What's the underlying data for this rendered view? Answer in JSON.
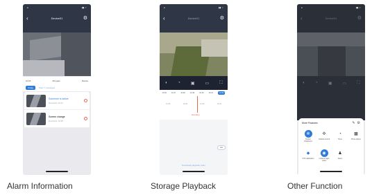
{
  "labels": {
    "alarm": "Alarm Information",
    "playback": "Storage Playback",
    "other": "Other Function"
  },
  "phone1": {
    "device_title": "Device01",
    "filter_left": "Oct 8",
    "filter_mid": "All types",
    "filter_right": "Device",
    "tab_active": "Today",
    "tab_inactive": "Past 7 messages",
    "alarms": [
      {
        "title": "Someone is active",
        "meta": "Device01  10:41"
      },
      {
        "title": "Screen change",
        "meta": "Device01  10:38"
      }
    ]
  },
  "phone2": {
    "title": "Device01",
    "times": [
      "10:36",
      "10:37",
      "10:38",
      "10:39",
      "10:40",
      "10:41"
    ],
    "times_selected": "10:42",
    "ticks": [
      "10:36",
      "10:38",
      "10:40",
      "10:42"
    ],
    "recording": "Recording",
    "list_btn": "List",
    "download": "Download playback video"
  },
  "phone3": {
    "panel_title": "More Features",
    "features": [
      {
        "icon": "brightness-icon",
        "glyph": "✲",
        "label": "Screen brightness",
        "style": "blue"
      },
      {
        "icon": "gimbal-icon",
        "glyph": "✣",
        "label": "Gimbal control",
        "style": "plain"
      },
      {
        "icon": "timer-icon",
        "glyph": "◔",
        "label": "Timer",
        "style": "plain"
      },
      {
        "icon": "photo-album-icon",
        "glyph": "▩",
        "label": "Photo album",
        "style": "plain"
      },
      {
        "icon": "ptz-icon",
        "glyph": "◆",
        "label": "PTZ calibration",
        "style": "plain"
      },
      {
        "icon": "night-vision-icon",
        "glyph": "◉",
        "label": "Infrared night vision",
        "style": "blue"
      },
      {
        "icon": "alarm-icon",
        "glyph": "♟",
        "label": "Alarm",
        "style": "plain"
      }
    ]
  }
}
